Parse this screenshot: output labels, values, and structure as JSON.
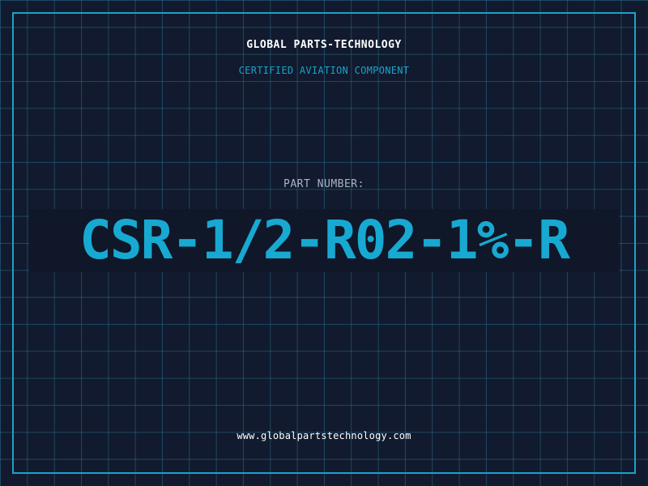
{
  "header": {
    "company": "GLOBAL PARTS-TECHNOLOGY",
    "tagline": "CERTIFIED AVIATION COMPONENT"
  },
  "part": {
    "label": "PART NUMBER:",
    "number": "CSR-1/2-R02-1%-R"
  },
  "footer": {
    "website": "www.globalpartstechnology.com"
  },
  "colors": {
    "background": "#111a2e",
    "grid": "#286e8c",
    "accent": "#1aa3c8",
    "part_number": "#17a9d2",
    "text": "#ffffff",
    "label": "#a9b4c4"
  }
}
